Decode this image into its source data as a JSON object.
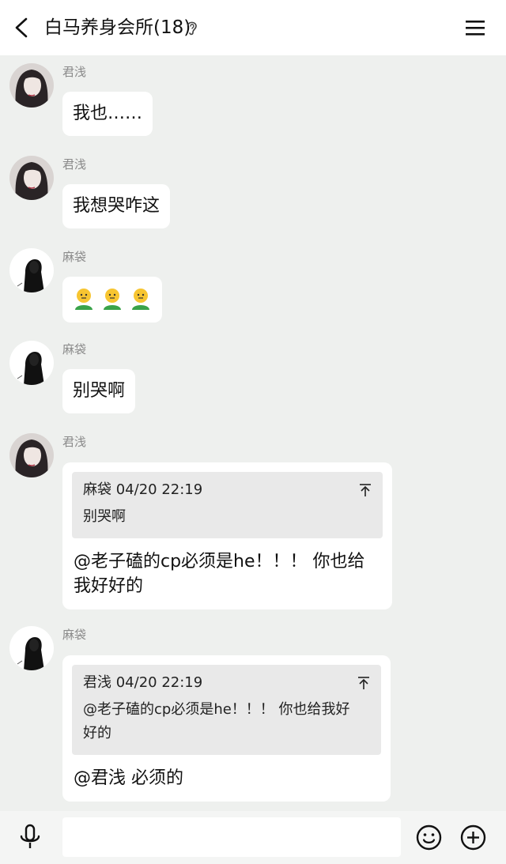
{
  "header": {
    "title": "白马养身会所(18)",
    "back_icon": "chevron-left-icon",
    "ear_icon": "ear-icon",
    "menu_icon": "hamburger-menu-icon"
  },
  "messages": [
    {
      "sender": "君浅",
      "text": "我也……"
    },
    {
      "sender": "君浅",
      "text": "我想哭咋这"
    },
    {
      "sender": "麻袋",
      "emoji": "smiley-person-emoji",
      "emoji_count": 3
    },
    {
      "sender": "麻袋",
      "text": "别哭啊"
    },
    {
      "sender": "君浅",
      "quote": {
        "head": "麻袋 04/20 22:19",
        "text": "别哭啊"
      },
      "reply_line1": "@老子磕的cp必须是he！！！ 你也给",
      "reply_line2": "我好好的"
    },
    {
      "sender": "麻袋",
      "quote": {
        "head": "君浅 04/20 22:19",
        "text_line1": "@老子磕的cp必须是he！！！ 你也给我好",
        "text_line2": "好的"
      },
      "reply_line1": "@君浅 必须的"
    }
  ],
  "input": {
    "value": "",
    "placeholder": ""
  },
  "colors": {
    "background": "#eef0ee",
    "bubble": "#ffffff",
    "quote": "#e9e9e9",
    "sender": "#8a8a8a"
  }
}
